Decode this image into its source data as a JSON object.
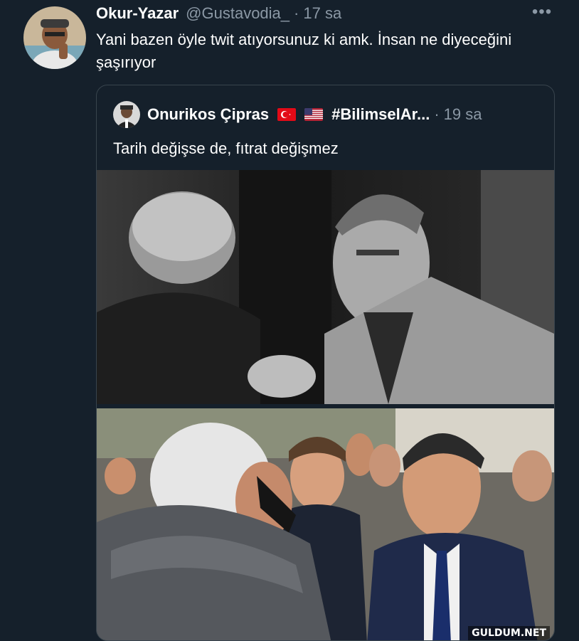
{
  "tweet": {
    "author_name": "Okur-Yazar",
    "handle": "@Gustavodia_",
    "separator": "·",
    "time": "17 sa",
    "more_label": "•••",
    "text": "Yani bazen öyle twit atıyorsunuz ki amk. İnsan ne diyeceğini şaşırıyor"
  },
  "quoted": {
    "author_name": "Onurikos Çipras",
    "flags": [
      "turkey-flag",
      "usa-flag"
    ],
    "hashtag": "#BilimselAr...",
    "separator": "·",
    "time": "19 sa",
    "text": "Tarih değişse de, fıtrat değişmez"
  },
  "watermark": "GULDUM.NET",
  "colors": {
    "background": "#15202b",
    "secondary_text": "#8b98a5",
    "border": "#38444d"
  }
}
